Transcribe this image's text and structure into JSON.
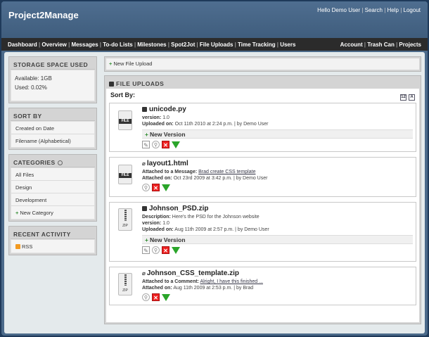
{
  "header": {
    "app_title": "Project2Manage",
    "user_links": [
      "Hello Demo User",
      "Search",
      "Help",
      "Logout"
    ]
  },
  "nav": {
    "left": [
      "Dashboard",
      "Overview",
      "Messages",
      "To-do Lists",
      "Milestones",
      "Spot2Jot",
      "File Uploads",
      "Time Tracking",
      "Users"
    ],
    "right": [
      "Account",
      "Trash Can",
      "Projects"
    ]
  },
  "sidebar": {
    "storage": {
      "title": "STORAGE SPACE USED",
      "available": "Available: 1GB",
      "used": "Used: 0.02%"
    },
    "sort": {
      "title": "SORT BY",
      "items": [
        "Created on Date",
        "Filename (Alphabetical)"
      ]
    },
    "categories": {
      "title": "CATEGORIES",
      "items": [
        "All Files",
        "Design",
        "Development"
      ],
      "new_label": "New Category"
    },
    "activity": {
      "title": "RECENT ACTIVITY",
      "rss": "RSS"
    }
  },
  "main": {
    "new_upload_label": "New File Upload",
    "panel_title": "FILE UPLOADS",
    "sort_label": "Sort By:",
    "sort_icons": [
      "12",
      "A"
    ],
    "new_version_label": "New Version",
    "files": [
      {
        "name": "unicode.py",
        "lines": [
          {
            "label": "version:",
            "value": "1.0"
          },
          {
            "label": "Uploaded on:",
            "value": "Oct 11th 2010 at 2:24 p.m. | by Demo User"
          }
        ]
      },
      {
        "name": "layout1.html",
        "lines": [
          {
            "label": "Attached to a Message:",
            "link": "Brad create CSS template"
          },
          {
            "label": "Attached on:",
            "value": "Oct 23rd 2009 at 3:42 p.m. | by Demo User"
          }
        ]
      },
      {
        "name": "Johnson_PSD.zip",
        "lines": [
          {
            "label": "Description:",
            "value": "Here's the PSD for the Johnson website"
          },
          {
            "label": "version:",
            "value": "1.0"
          },
          {
            "label": "Uploaded on:",
            "value": "Aug 11th 2009 at 2:57 p.m. | by Demo User"
          }
        ]
      },
      {
        "name": "Johnson_CSS_template.zip",
        "lines": [
          {
            "label": "Attached to a Comment:",
            "link": "Alright, I have this finished ..."
          },
          {
            "label": "Attached on:",
            "value": "Aug 11th 2009 at 2:53 p.m. | by Brad"
          }
        ]
      }
    ]
  }
}
